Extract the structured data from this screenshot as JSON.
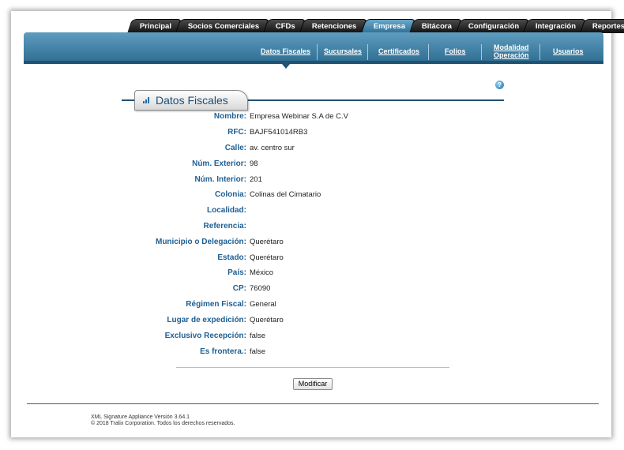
{
  "tabs": [
    "Principal",
    "Socios Comerciales",
    "CFDs",
    "Retenciones",
    "Empresa",
    "Bitácora",
    "Configuración",
    "Integración",
    "Reportes"
  ],
  "active_tab": "Empresa",
  "subnav": {
    "datos_fiscales": "Datos Fiscales",
    "sucursales": "Sucursales",
    "certificados": "Certificados",
    "folios": "Folios",
    "modalidad_1": "Modalidad",
    "modalidad_2": "Operación",
    "usuarios": "Usuarios"
  },
  "help_icon_glyph": "?",
  "section": {
    "title": "Datos Fiscales"
  },
  "fields": [
    {
      "label": "Nombre:",
      "value": "Empresa Webinar S.A de C.V"
    },
    {
      "label": "RFC:",
      "value": "BAJF541014RB3"
    },
    {
      "label": "Calle:",
      "value": "av. centro sur"
    },
    {
      "label": "Núm. Exterior:",
      "value": "98"
    },
    {
      "label": "Núm. Interior:",
      "value": "201"
    },
    {
      "label": "Colonia:",
      "value": "Colinas del Cimatario"
    },
    {
      "label": "Localidad:",
      "value": ""
    },
    {
      "label": "Referencia:",
      "value": ""
    },
    {
      "label": "Municipio o Delegación:",
      "value": "Querétaro"
    },
    {
      "label": "Estado:",
      "value": "Querétaro"
    },
    {
      "label": "País:",
      "value": "México"
    },
    {
      "label": "CP:",
      "value": "76090"
    },
    {
      "label": "Régimen Fiscal:",
      "value": "General"
    },
    {
      "label": "Lugar de expedición:",
      "value": "Querétaro"
    },
    {
      "label": "Exclusivo Recepción:",
      "value": "false"
    },
    {
      "label": "Es frontera.:",
      "value": "false"
    }
  ],
  "modify_button": "Modificar",
  "footer": {
    "version": "XML Signature Appliance Versión 3.64.1",
    "copyright": "© 2018 Tralix Corporation. Todos los derechos reservados."
  },
  "colors": {
    "band": "#2d6b8f",
    "label": "#1e5f93"
  }
}
